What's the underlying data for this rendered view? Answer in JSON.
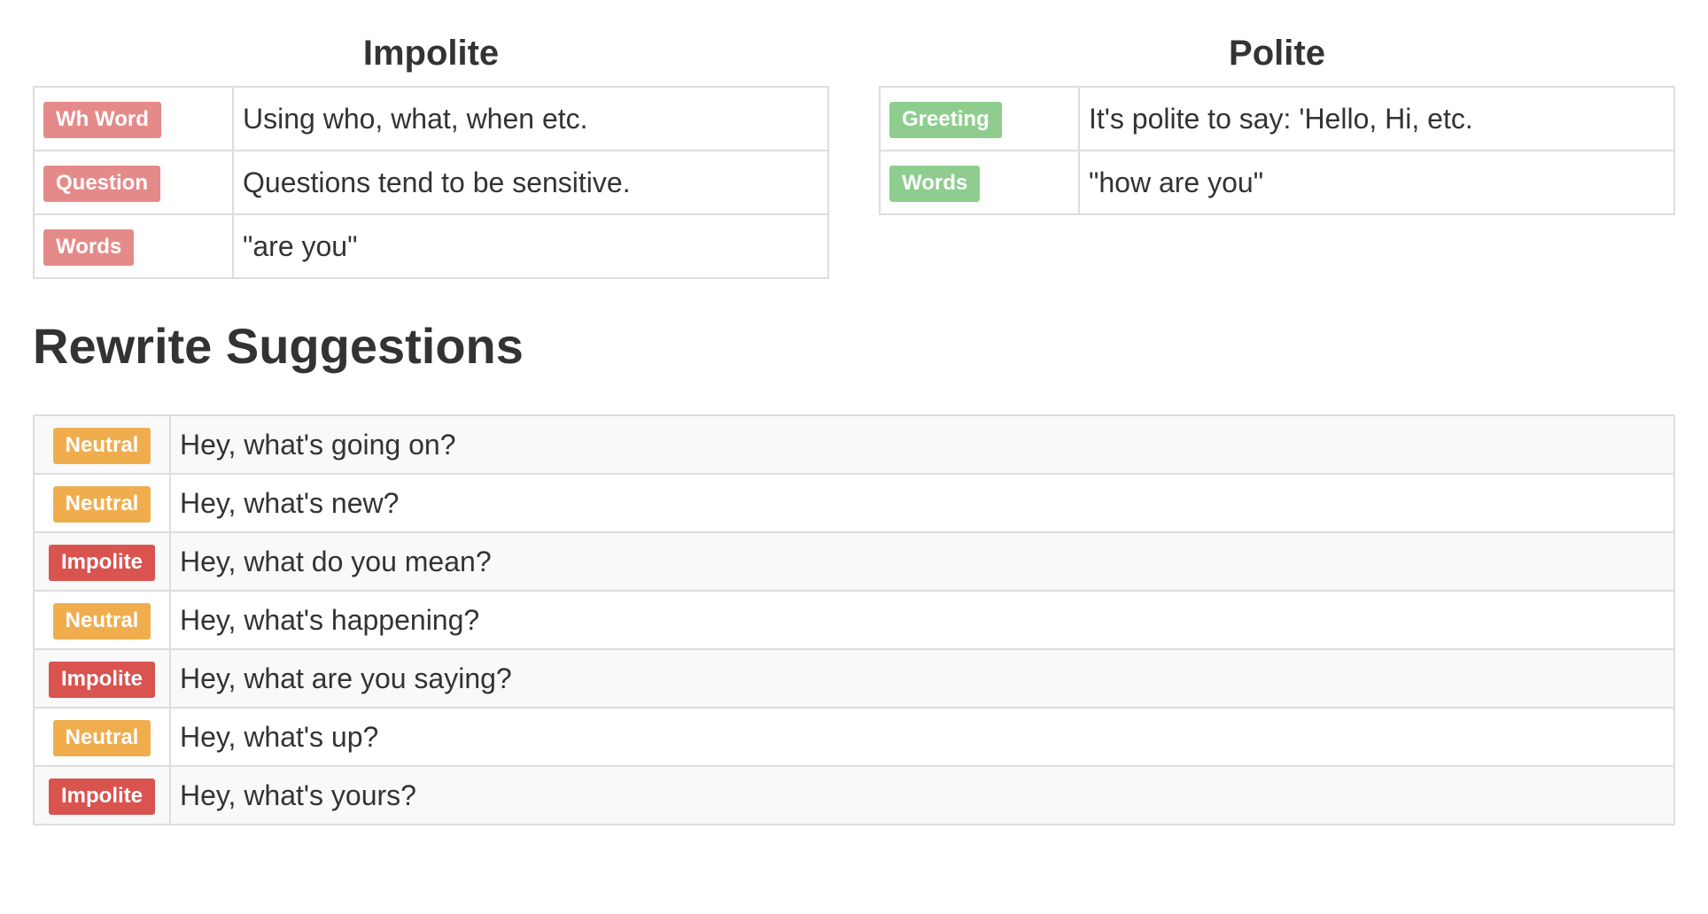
{
  "impolite": {
    "title": "Impolite",
    "rows": [
      {
        "label": "Wh Word",
        "text": "Using who, what, when etc."
      },
      {
        "label": "Question",
        "text": "Questions tend to be sensitive."
      },
      {
        "label": "Words",
        "text": "\"are you\""
      }
    ]
  },
  "polite": {
    "title": "Polite",
    "rows": [
      {
        "label": "Greeting",
        "text": "It's polite to say: 'Hello, Hi, etc."
      },
      {
        "label": "Words",
        "text": "\"how are you\""
      }
    ]
  },
  "suggestions": {
    "title": "Rewrite Suggestions",
    "rows": [
      {
        "label": "Neutral",
        "text": "Hey, what's going on?"
      },
      {
        "label": "Neutral",
        "text": "Hey, what's new?"
      },
      {
        "label": "Impolite",
        "text": "Hey, what do you mean?"
      },
      {
        "label": "Neutral",
        "text": "Hey, what's happening?"
      },
      {
        "label": "Impolite",
        "text": "Hey, what are you saying?"
      },
      {
        "label": "Neutral",
        "text": "Hey, what's up?"
      },
      {
        "label": "Impolite",
        "text": "Hey, what's yours?"
      }
    ]
  },
  "colors": {
    "impolite_feature_label": "#e58a8a",
    "polite_feature_label": "#8fcd8f",
    "neutral_label": "#f0ad4e",
    "impolite_label": "#d9534f",
    "table_border": "#dddddd",
    "striped_row": "#f9f9f9",
    "text": "#333333"
  }
}
